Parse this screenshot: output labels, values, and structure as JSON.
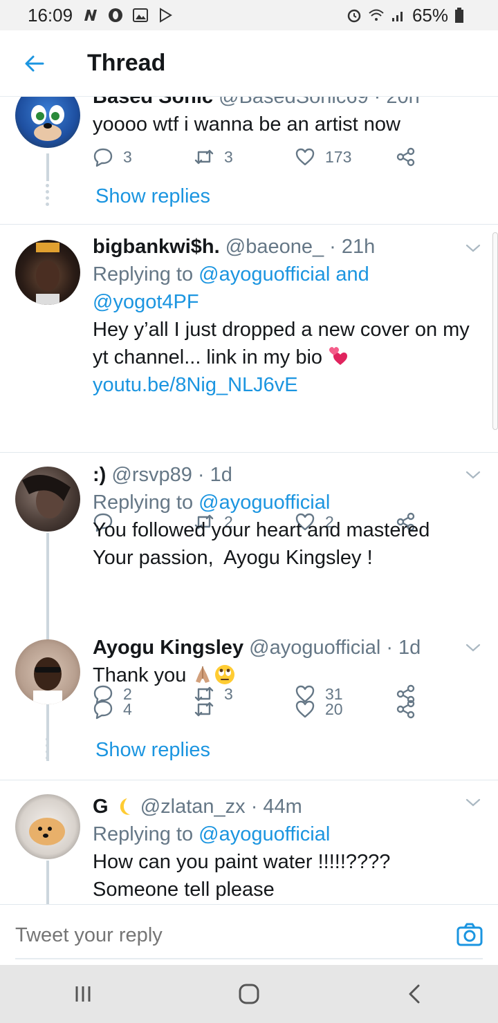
{
  "status_bar": {
    "time": "16:09",
    "battery": "65%",
    "left_icons": [
      "n-app-icon",
      "opera-icon",
      "gallery-icon",
      "play-store-icon"
    ],
    "right_icons": [
      "alarm-icon",
      "wifi-icon",
      "signal-icon",
      "battery-icon"
    ]
  },
  "header": {
    "title": "Thread",
    "accent": "#1b95e0"
  },
  "tweets": [
    {
      "name_partial": "Based Sonic",
      "handle_partial": "@BasedSonic69 · 20h",
      "text": "yoooo wtf i wanna be an artist now",
      "replies": "3",
      "retweets": "3",
      "likes": "173",
      "show_replies": "Show replies"
    },
    {
      "name": "bigbankwi$h.",
      "handle": "@baeone_ · 21h",
      "replying_label": "Replying to",
      "replying_to": "@ayoguofficial and",
      "replying_to_2": "@yogot4PF",
      "text_line1": "Hey y’all I just dropped a new cover on my",
      "text_line2": "yt channel... link in my bio",
      "link": "youtu.be/8Nig_NLJ6vE",
      "replies": "",
      "retweets": "2",
      "likes": "2"
    },
    {
      "name": ":)",
      "handle": "@rsvp89 · 1d",
      "replying_label": "Replying to",
      "replying_to": "@ayoguofficial",
      "text_line1": "You followed your heart and mastered",
      "text_line2": "Your passion,  Ayogu Kingsley !",
      "replies": "2",
      "retweets": "3",
      "likes": "31"
    },
    {
      "name": "Ayogu Kingsley",
      "handle": "@ayoguofficial · 1d",
      "text": "Thank you",
      "replies": "4",
      "retweets": "",
      "likes": "20",
      "show_replies": "Show replies"
    },
    {
      "name": "G",
      "handle": "@zlatan_zx · 44m",
      "replying_label": "Replying to",
      "replying_to": "@ayoguofficial",
      "text_line1": "How can you paint water !!!!!????",
      "text_line2": "Someone tell please"
    }
  ],
  "composer": {
    "placeholder": "Tweet your reply"
  },
  "colors": {
    "accent": "#1b95e0",
    "secondary_text": "#657786",
    "primary_text": "#14171a",
    "like_icon": "#657786"
  }
}
